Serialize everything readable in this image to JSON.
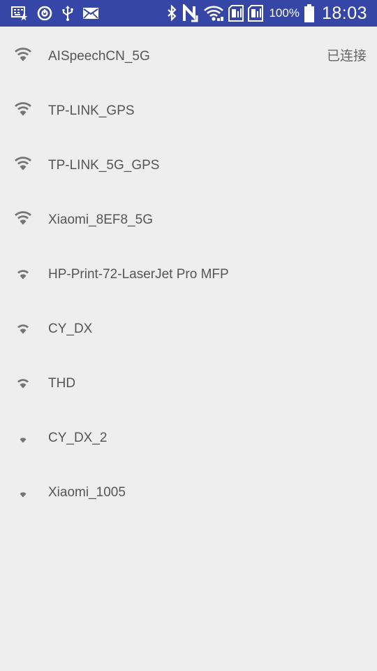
{
  "status_bar": {
    "battery_percent": "100%",
    "time": "18:03",
    "background_color": "#3646a6",
    "left_icons": [
      "keyboard-star-icon",
      "sync-icon",
      "usb-icon",
      "mail-icon"
    ],
    "right_icons": [
      "bluetooth-icon",
      "nfc-icon",
      "wifi-icon",
      "sim-card-1-icon",
      "sim-card-2-icon",
      "battery-icon"
    ]
  },
  "networks": [
    {
      "ssid": "AISpeechCN_5G",
      "status": "已连接",
      "signal_bars": 3
    },
    {
      "ssid": "TP-LINK_GPS",
      "status": "",
      "signal_bars": 3
    },
    {
      "ssid": "TP-LINK_5G_GPS",
      "status": "",
      "signal_bars": 3
    },
    {
      "ssid": "Xiaomi_8EF8_5G",
      "status": "",
      "signal_bars": 3
    },
    {
      "ssid": "HP-Print-72-LaserJet Pro MFP",
      "status": "",
      "signal_bars": 2
    },
    {
      "ssid": "CY_DX",
      "status": "",
      "signal_bars": 2
    },
    {
      "ssid": "THD",
      "status": "",
      "signal_bars": 2
    },
    {
      "ssid": "CY_DX_2",
      "status": "",
      "signal_bars": 1
    },
    {
      "ssid": "Xiaomi_1005",
      "status": "",
      "signal_bars": 1
    }
  ],
  "colors": {
    "background": "#eeeeee",
    "text": "#555555",
    "signal_icon": "#757575"
  }
}
